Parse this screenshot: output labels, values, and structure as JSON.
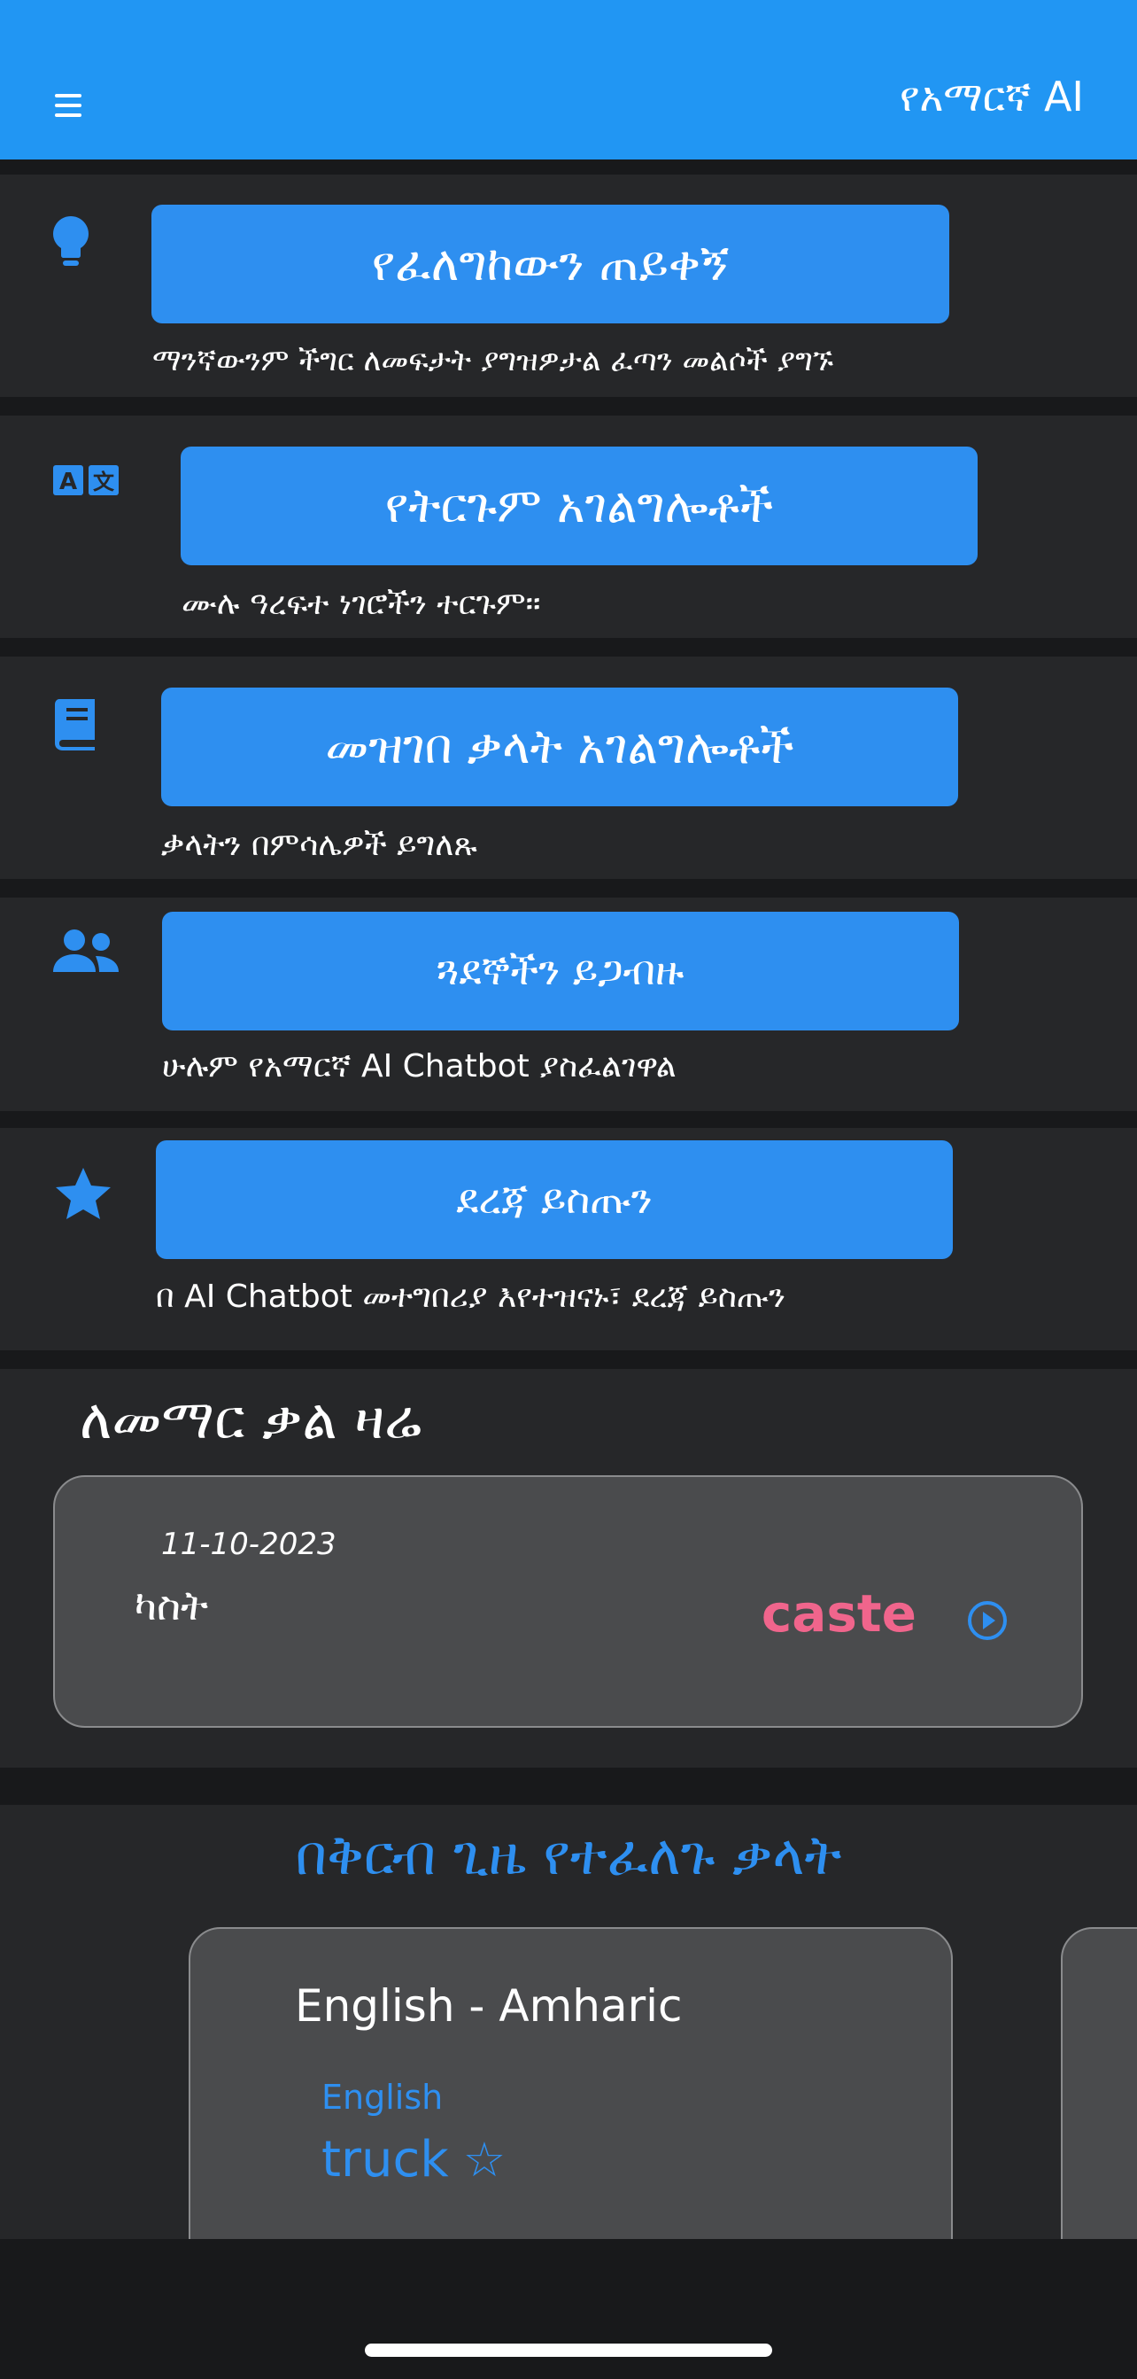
{
  "header": {
    "title": "የአማርኛ AI",
    "menu_icon": "menu-icon"
  },
  "features": [
    {
      "icon": "lightbulb-icon",
      "button_label": "የፈለግከውን ጠይቀኝ",
      "description": "ማንኛውንም ችግር ለመፍታት ያግዝዎታል ፈጣን መልሶች ያግኙ"
    },
    {
      "icon": "translate-icon",
      "button_label": "የትርጉም አገልግሎቶች",
      "description": "ሙሉ ዓረፍተ ነገሮችን ተርጉም።"
    },
    {
      "icon": "book-icon",
      "button_label": "መዝገበ ቃላት አገልግሎቶች",
      "description": "ቃላትን በምሳሌዎች ይግለጹ"
    },
    {
      "icon": "people-icon",
      "button_label": "ጓደኞችን ይጋብዙ",
      "description": "ሁሉም የአማርኛ AI Chatbot ያስፈልገዋል"
    },
    {
      "icon": "star-icon",
      "button_label": "ደረጃ ይስጡን",
      "description": "በ AI Chatbot መተግበሪያ እየተዝናኑ፣ ደረጃ ይስጡን"
    }
  ],
  "word_of_day": {
    "heading": "ለመማር ቃል ዛሬ",
    "date": "11-10-2023",
    "amharic": "ካስት",
    "english": "caste",
    "play_icon": "play-circle-icon",
    "english_color": "#f0658c"
  },
  "recent": {
    "heading": "በቅርብ ጊዜ የተፈለጉ ቃላት",
    "cards": [
      {
        "title": "English - Amharic",
        "language": "English",
        "word": "truck",
        "favorite_icon": "star-outline-icon"
      }
    ]
  },
  "colors": {
    "accent": "#2e8ff0",
    "appbar": "#2196f3",
    "background": "#18191b",
    "card": "#262729",
    "highlight": "#f0658c"
  }
}
